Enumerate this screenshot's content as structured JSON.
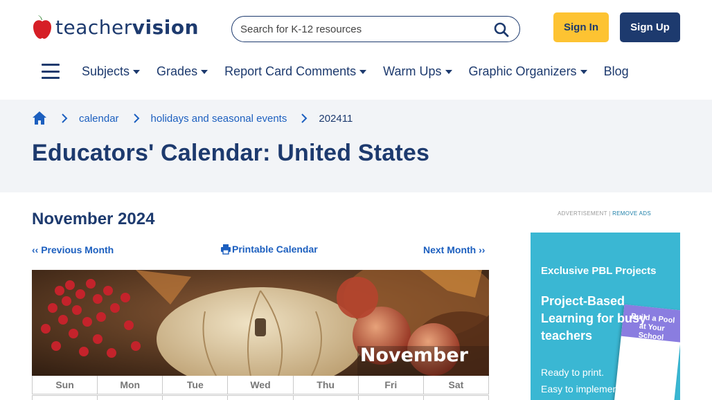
{
  "header": {
    "logo": {
      "light": "teacher",
      "bold": "vision"
    },
    "search": {
      "placeholder": "Search for K-12 resources"
    },
    "sign_in": "Sign In",
    "sign_up": "Sign Up",
    "nav": [
      {
        "label": "Subjects",
        "dropdown": true
      },
      {
        "label": "Grades",
        "dropdown": true
      },
      {
        "label": "Report Card Comments",
        "dropdown": true
      },
      {
        "label": "Warm Ups",
        "dropdown": true
      },
      {
        "label": "Graphic Organizers",
        "dropdown": true
      },
      {
        "label": "Blog",
        "dropdown": false
      }
    ]
  },
  "breadcrumb": {
    "home_icon": "home-icon",
    "items": [
      "calendar",
      "holidays and seasonal events"
    ],
    "current": "202411"
  },
  "page_title": "Educators' Calendar: United States",
  "calendar": {
    "month_title": "November 2024",
    "prev_link": "‹‹ Previous Month",
    "print_link": "Printable Calendar",
    "next_link": "Next Month ››",
    "banner_label": "November",
    "weekdays": [
      "Sun",
      "Mon",
      "Tue",
      "Wed",
      "Thu",
      "Fri",
      "Sat"
    ]
  },
  "ad": {
    "label": "ADVERTISEMENT |",
    "remove": "REMOVE ADS",
    "kicker": "Exclusive PBL Projects",
    "title": "Project-Based Learning for busy teachers",
    "line1": "Ready to print.",
    "line2": "Easy to implement.",
    "book_title": "Build a Pool at Your School"
  },
  "colors": {
    "navy": "#1d3a6e",
    "link": "#1c5fbf",
    "signin": "#fdc332",
    "band": "#f2f4f7",
    "ad": "#3ab7d3"
  }
}
